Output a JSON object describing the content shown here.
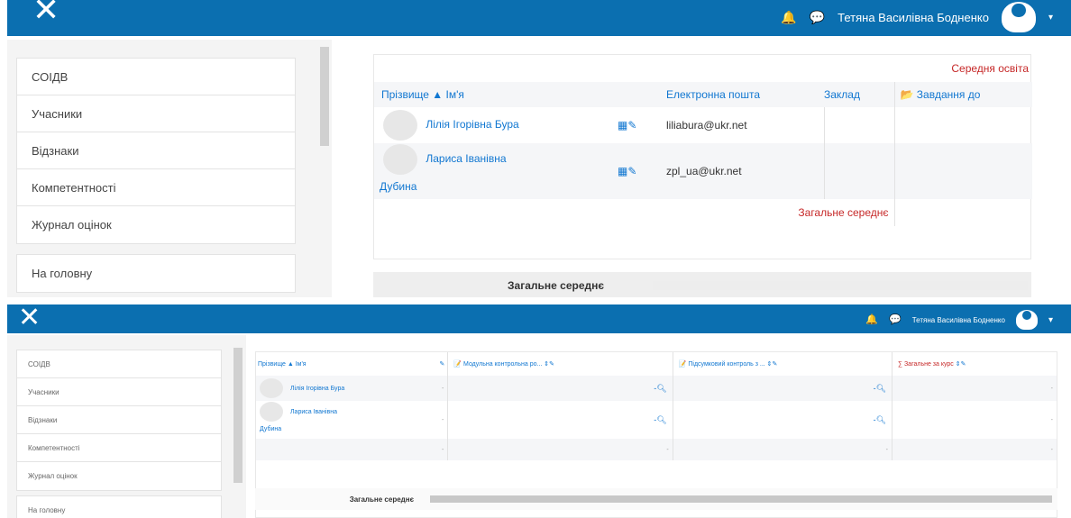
{
  "navbar": {
    "close_symbol": "✕",
    "bell_icon": "🔔",
    "message_icon": "💬",
    "user_name": "Тетяна Василівна Бодненко",
    "caret": "▾",
    "color": "#0b6fb0"
  },
  "sidebar": {
    "items": [
      "СОІДВ",
      "Учасники",
      "Відзнаки",
      "Компетентності",
      "Журнал оцінок"
    ],
    "home": "На головну"
  },
  "grader_top": {
    "category_header": "Середня освіта",
    "sort_header": "Прізвище ▲ Ім'я",
    "email_header": "Електронна пошта",
    "institution_header": "Заклад",
    "assignment_header": "Завдання до",
    "rows": [
      {
        "name": "Лілія Ігорівна Бура",
        "email": "liliabura@ukr.net"
      },
      {
        "name_line1": "Лариса Іванівна",
        "name_line2": "Дубина",
        "email": "zpl_ua@ukr.net"
      }
    ],
    "overall_average_red": "Загальне середнє",
    "overall_average_bottom": "Загальне середнє"
  },
  "grader_bottom": {
    "sort_header": "Прізвище ▲ Ім'я",
    "col1_header": "Модульна контрольна ро...",
    "col2_header": "Підсумковий контроль з ...",
    "col3_header": "Загальне за курс",
    "rows": [
      {
        "name": "Лілія Ігорівна Бура",
        "c0": "-",
        "c1": "-",
        "c2": "-",
        "c3": "-"
      },
      {
        "name_line1": "Лариса Іванівна",
        "name_line2": "Дубина",
        "c0": "-",
        "c1": "-",
        "c2": "-",
        "c3": "-"
      }
    ],
    "average_row": {
      "c0": "-",
      "c1": "-",
      "c2": "-",
      "c3": "-"
    },
    "overall_average": "Загальне середнє"
  }
}
